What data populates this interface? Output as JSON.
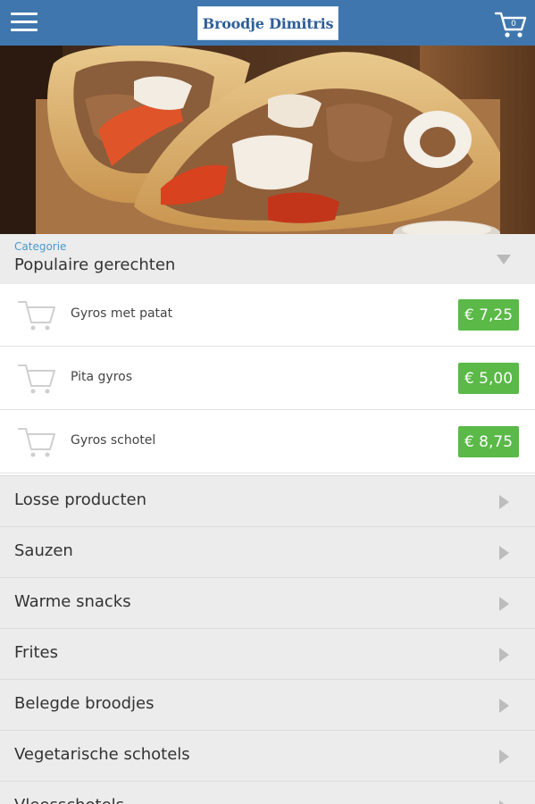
{
  "header": {
    "logo_text": "Broodje Dimitris",
    "menu_icon": "hamburger-menu-icon",
    "cart_icon": "shopping-cart-icon",
    "cart_count": "0",
    "color": "#3f76ad"
  },
  "category_selector": {
    "caption": "Categorie",
    "selected": "Populaire gerechten"
  },
  "products": [
    {
      "name": "Gyros met patat",
      "price": "€ 7,25"
    },
    {
      "name": "Pita gyros",
      "price": "€ 5,00"
    },
    {
      "name": "Gyros schotel",
      "price": "€ 8,75"
    }
  ],
  "categories": [
    {
      "label": "Losse producten"
    },
    {
      "label": "Sauzen"
    },
    {
      "label": "Warme snacks"
    },
    {
      "label": "Frites"
    },
    {
      "label": "Belegde broodjes"
    },
    {
      "label": "Vegetarische schotels"
    },
    {
      "label": "Vleesschotels"
    }
  ],
  "colors": {
    "price_badge": "#5ab947",
    "caption": "#4a9acb",
    "list_background": "#ececec"
  }
}
